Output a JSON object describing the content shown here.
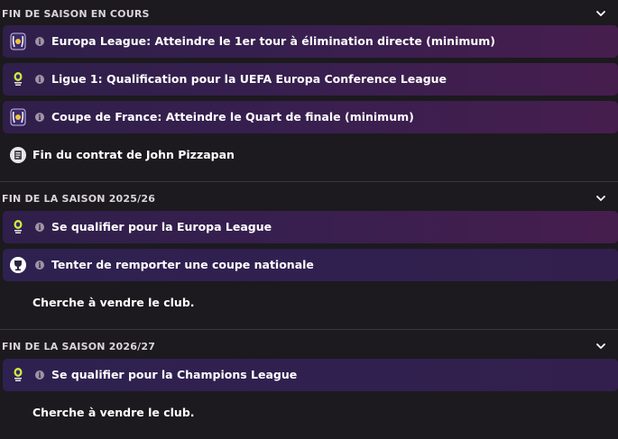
{
  "sections": [
    {
      "title": "FIN DE SAISON EN COURS",
      "items": [
        {
          "text": "Europa League: Atteindre le 1er tour à élimination directe (minimum)",
          "icon": "europa-league-icon"
        },
        {
          "text": "Ligue 1: Qualification pour la UEFA Europa Conference League",
          "icon": "ligue1-icon"
        },
        {
          "text": "Coupe de France: Atteindre le Quart de finale (minimum)",
          "icon": "europa-league-icon"
        },
        {
          "text": "Fin du contrat de John Pizzapan",
          "icon": "contract-icon"
        }
      ]
    },
    {
      "title": "FIN DE LA SAISON 2025/26",
      "items": [
        {
          "text": "Se qualifier pour la Europa League",
          "icon": "ligue1-icon"
        },
        {
          "text": "Tenter de remporter une coupe nationale",
          "icon": "trophy-icon"
        },
        {
          "text": "Cherche à vendre le club."
        }
      ]
    },
    {
      "title": "FIN DE LA SAISON 2026/27",
      "items": [
        {
          "text": "Se qualifier pour la Champions League",
          "icon": "ligue1-icon"
        },
        {
          "text": "Cherche à vendre le club."
        }
      ]
    }
  ],
  "colors": {
    "background": "#1c1a1e",
    "row_gradient_start": "#2f1f4a",
    "row_gradient_end": "#461e4e",
    "divider": "#3a353e"
  }
}
